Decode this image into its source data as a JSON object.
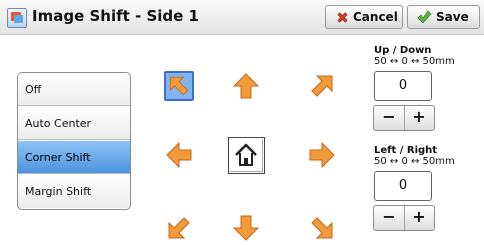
{
  "window": {
    "title": "Image Shift - Side 1"
  },
  "header": {
    "cancel_label": "Cancel",
    "save_label": "Save"
  },
  "shift_modes": [
    {
      "label": "Off",
      "selected": false
    },
    {
      "label": "Auto Center",
      "selected": false
    },
    {
      "label": "Corner Shift",
      "selected": true
    },
    {
      "label": "Margin Shift",
      "selected": false
    }
  ],
  "direction_pad": {
    "selected": "up-left",
    "arrow_color": "#f39a3a",
    "selected_bg": "#7fb4ee"
  },
  "up_down": {
    "label": "Up / Down",
    "range": "50 ↔ 0 ↔ 50mm",
    "value": "0",
    "minus": "−",
    "plus": "+"
  },
  "left_right": {
    "label": "Left / Right",
    "range": "50 ↔ 0 ↔ 50mm",
    "value": "0",
    "minus": "−",
    "plus": "+"
  },
  "colors": {
    "selected_item": "#4c93df",
    "cancel_x": "#d63a2a",
    "save_check": "#5cb33a"
  }
}
